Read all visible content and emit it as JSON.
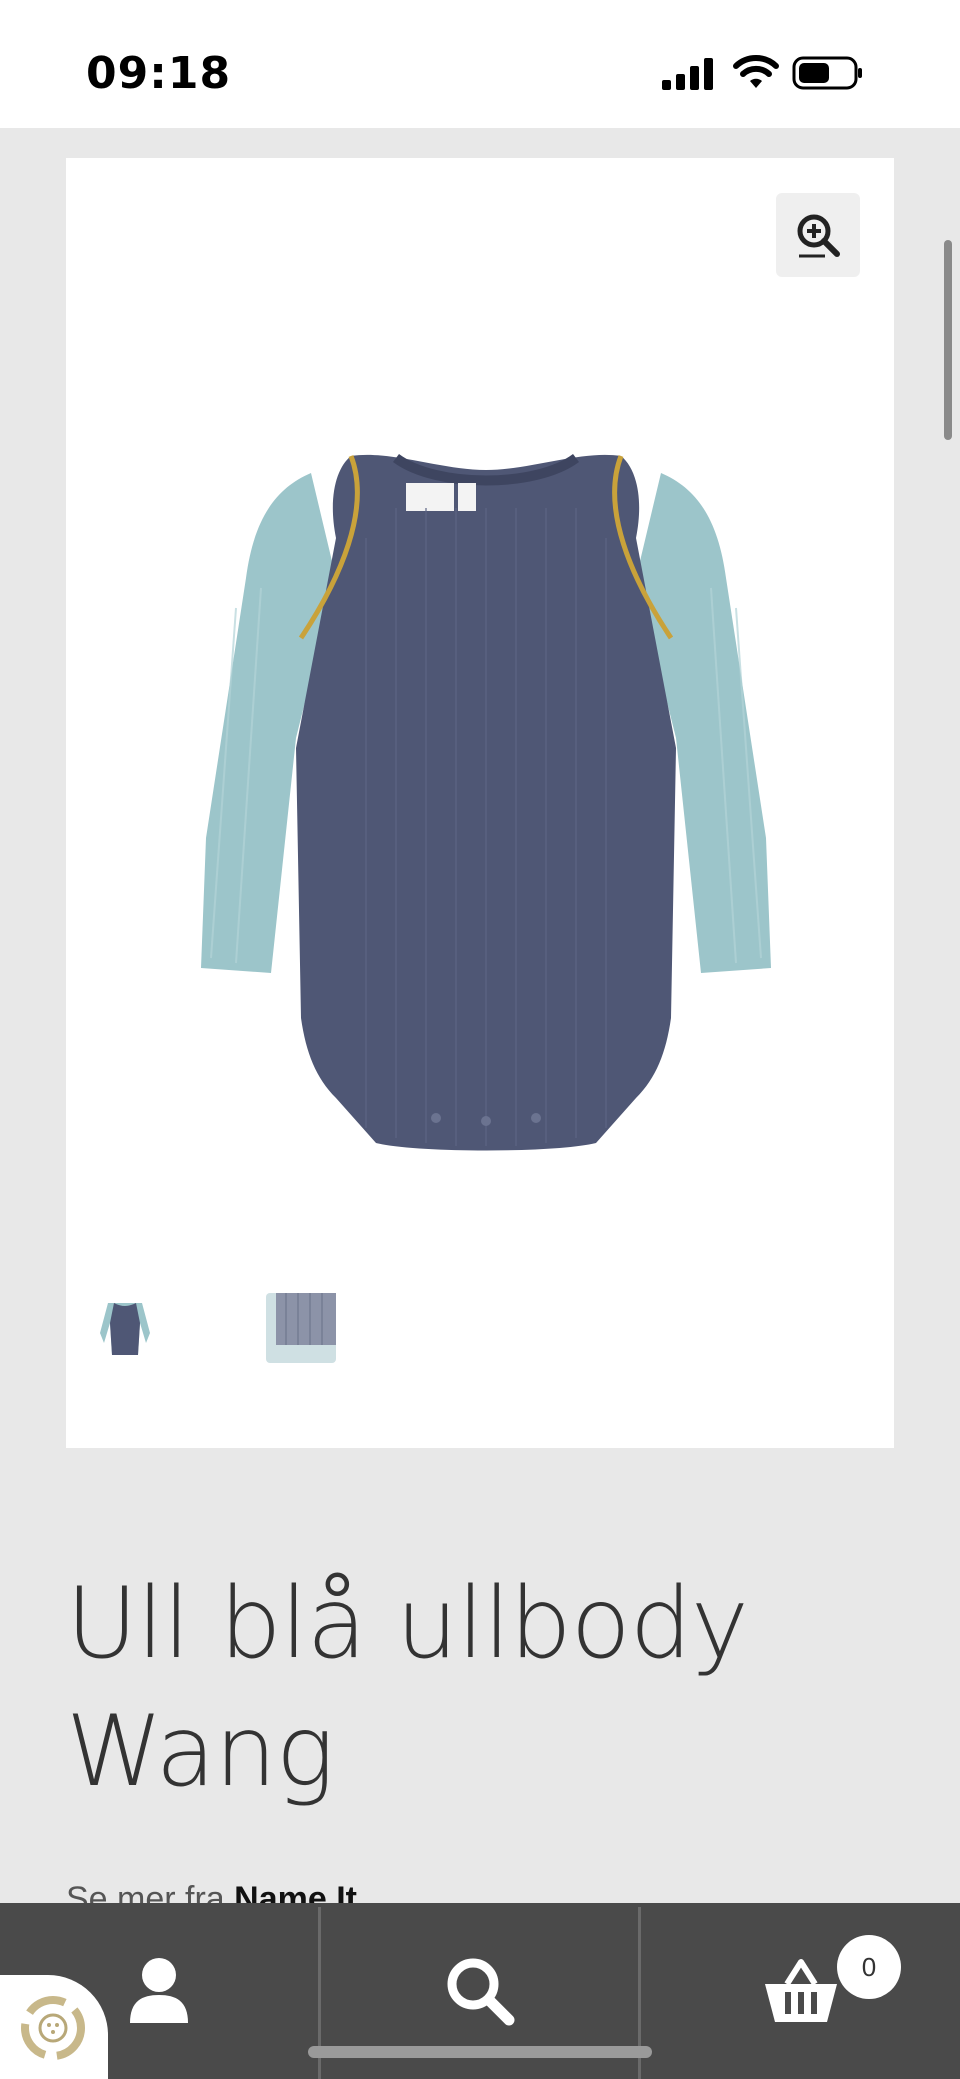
{
  "status_bar": {
    "time": "09:18",
    "icons": [
      "signal-icon",
      "wifi-icon",
      "battery-icon"
    ]
  },
  "product": {
    "title_line1": "Ull blå ullbody",
    "title_line2": "Wang",
    "brand_prefix": "Se mer fra ",
    "brand_name": "Name It",
    "images": [
      "main-product-image",
      "thumbnail-front",
      "thumbnail-fabric-detail"
    ],
    "zoom_icon": "zoom-in-icon"
  },
  "bottom_nav": {
    "items": [
      {
        "icon": "user-icon"
      },
      {
        "icon": "search-icon"
      },
      {
        "icon": "basket-icon",
        "badge": "0"
      }
    ]
  },
  "colors": {
    "page_bg": "#e8e8e8",
    "nav_bg": "#4a4a4a",
    "body_navy": "#4f5775",
    "sleeve_blue": "#9cc5ca",
    "seam_gold": "#c9a23a"
  }
}
